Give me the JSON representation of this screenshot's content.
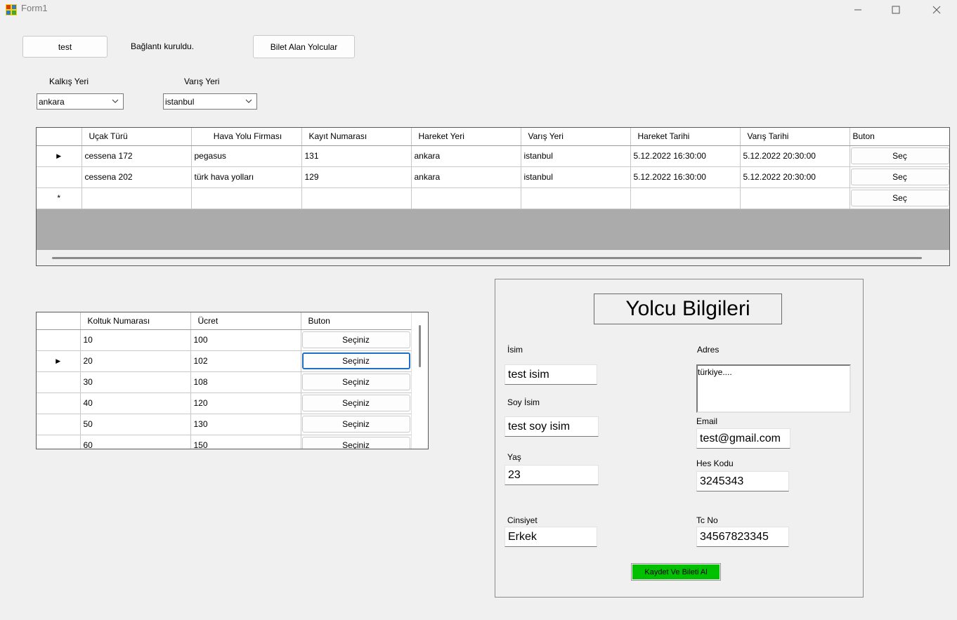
{
  "window": {
    "title": "Form1"
  },
  "toolbar": {
    "test_button": "test",
    "status_text": "Bağlantı kuruldu.",
    "passengers_button": "Bilet Alan Yolcular"
  },
  "filters": {
    "departure_label": "Kalkış Yeri",
    "departure_value": "ankara",
    "arrival_label": "Varış Yeri",
    "arrival_value": "istanbul"
  },
  "flights": {
    "headers": [
      "Uçak Türü",
      "Hava Yolu Firması",
      "Kayıt Numarası",
      "Hareket Yeri",
      "Varış Yeri",
      "Hareket Tarihi",
      "Varış Tarihi",
      "Buton"
    ],
    "rows": [
      {
        "plane": "cessena 172",
        "airline": "pegasus",
        "reg": "131",
        "from": "ankara",
        "to": "istanbul",
        "dep": "5.12.2022 16:30:00",
        "arr": "5.12.2022 20:30:00",
        "btn": "Seç"
      },
      {
        "plane": "cessena 202",
        "airline": "türk hava yolları",
        "reg": "129",
        "from": "ankara",
        "to": "istanbul",
        "dep": "5.12.2022 16:30:00",
        "arr": "5.12.2022 20:30:00",
        "btn": "Seç"
      }
    ],
    "new_row_btn": "Seç",
    "new_row_marker": "*",
    "current_row_marker": "▶"
  },
  "seats": {
    "headers": [
      "Koltuk Numarası",
      "Ücret",
      "Buton"
    ],
    "rows": [
      {
        "seat": "10",
        "price": "100",
        "btn": "Seçiniz"
      },
      {
        "seat": "20",
        "price": "102",
        "btn": "Seçiniz"
      },
      {
        "seat": "30",
        "price": "108",
        "btn": "Seçiniz"
      },
      {
        "seat": "40",
        "price": "120",
        "btn": "Seçiniz"
      },
      {
        "seat": "50",
        "price": "130",
        "btn": "Seçiniz"
      },
      {
        "seat": "60",
        "price": "150",
        "btn": "Seçiniz"
      }
    ],
    "current_row_marker": "▶"
  },
  "passenger": {
    "title": "Yolcu Bilgileri",
    "name_label": "İsim",
    "name_value": "test isim",
    "surname_label": "Soy İsim",
    "surname_value": "test soy isim",
    "age_label": "Yaş",
    "age_value": "23",
    "gender_label": "Cinsiyet",
    "gender_value": "Erkek",
    "address_label": "Adres",
    "address_value": "türkiye....",
    "email_label": "Email",
    "email_value": "test@gmail.com",
    "hes_label": "Hes Kodu",
    "hes_value": "3245343",
    "tc_label": "Tc No",
    "tc_value": "34567823345",
    "submit_button": "Kaydet Ve Bileti Al",
    "submit_color": "#00c000"
  }
}
